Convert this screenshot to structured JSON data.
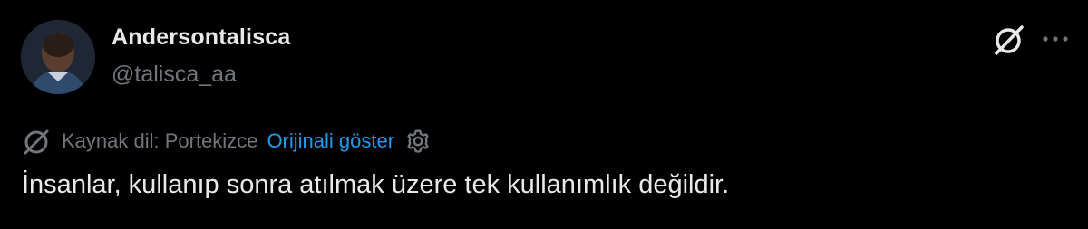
{
  "author": {
    "display_name": "Andersontalisca",
    "handle": "@talisca_aa"
  },
  "translation": {
    "source_label": "Kaynak dil: Portekizce",
    "show_original_label": "Orijinali göster"
  },
  "tweet": {
    "text": "İnsanlar, kullanıp sonra atılmak üzere tek kullanımlık değildir."
  },
  "icons": {
    "grok": "grok-icon",
    "more": "more-icon",
    "translate": "translate-icon",
    "settings": "gear-icon"
  },
  "colors": {
    "background": "#000000",
    "primary_text": "#e7e9ea",
    "secondary_text": "#71767b",
    "link": "#1d9bf0"
  }
}
